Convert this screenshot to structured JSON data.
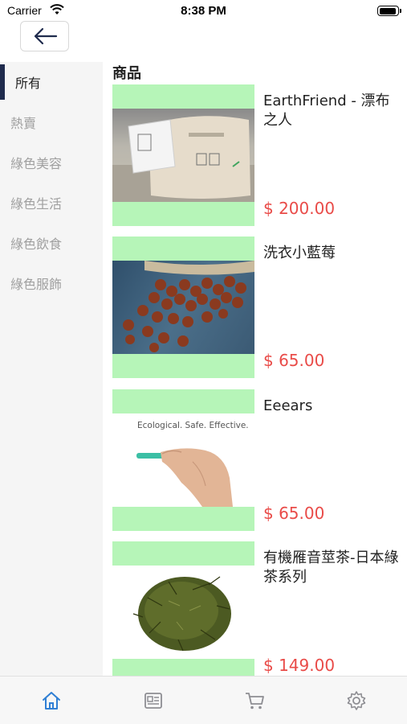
{
  "status_bar": {
    "carrier": "Carrier",
    "time": "8:38 PM",
    "battery_level": 0.9
  },
  "nav": {
    "back_icon": "arrow-left-icon"
  },
  "sidebar": {
    "items": [
      {
        "label": "所有",
        "active": true
      },
      {
        "label": "熱賣",
        "active": false
      },
      {
        "label": "綠色美容",
        "active": false
      },
      {
        "label": "綠色生活",
        "active": false
      },
      {
        "label": "綠色飲食",
        "active": false
      },
      {
        "label": "綠色服飾",
        "active": false
      }
    ]
  },
  "content": {
    "section_title": "商品",
    "products": [
      {
        "name": "EarthFriend - 漂布之人",
        "price": "$ 200.00"
      },
      {
        "name": "洗衣小藍莓",
        "price": "$ 65.00"
      },
      {
        "name": "Eeears",
        "price": "$ 65.00",
        "image_caption": "Ecological. Safe. Effective."
      },
      {
        "name": "有機雁音莖茶-日本綠茶系列",
        "price": "$ 149.00"
      }
    ]
  },
  "tab_bar": {
    "tabs": [
      {
        "icon": "home-icon",
        "active": true
      },
      {
        "icon": "news-icon",
        "active": false
      },
      {
        "icon": "cart-icon",
        "active": false
      },
      {
        "icon": "gear-icon",
        "active": false
      }
    ]
  },
  "colors": {
    "price": "#e94b48",
    "image_placeholder": "#b6f5b8",
    "active_indicator": "#1f2b4d",
    "active_tab": "#2f7fd4",
    "inactive_tab": "#8e8e93"
  }
}
